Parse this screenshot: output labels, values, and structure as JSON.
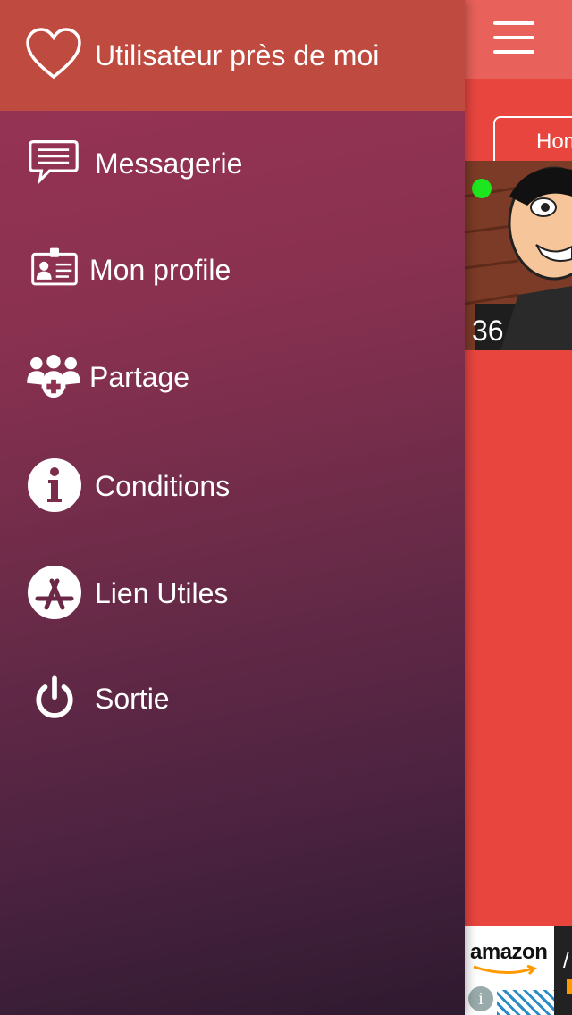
{
  "drawer": {
    "header_title": "Utilisateur près de moi",
    "items": [
      {
        "label": "Messagerie",
        "icon": "message-icon"
      },
      {
        "label": "Mon profile",
        "icon": "id-card-icon"
      },
      {
        "label": "Partage",
        "icon": "group-add-icon"
      },
      {
        "label": "Conditions",
        "icon": "info-icon"
      },
      {
        "label": "Lien Utiles",
        "icon": "app-store-icon"
      },
      {
        "label": "Sortie",
        "icon": "power-icon"
      }
    ]
  },
  "app": {
    "filter_label": "Hom",
    "user_card": {
      "age": "36",
      "online": true,
      "online_color": "#1ee61e"
    },
    "ad": {
      "brand": "amazon",
      "right_char": "/",
      "info_glyph": "i"
    }
  },
  "colors": {
    "header_bg": "#bf4a3f",
    "app_bg": "#e8453f",
    "topbar_bg": "#e8615a",
    "drawer_top": "#9b3455",
    "drawer_bottom": "#2e1a2f"
  }
}
